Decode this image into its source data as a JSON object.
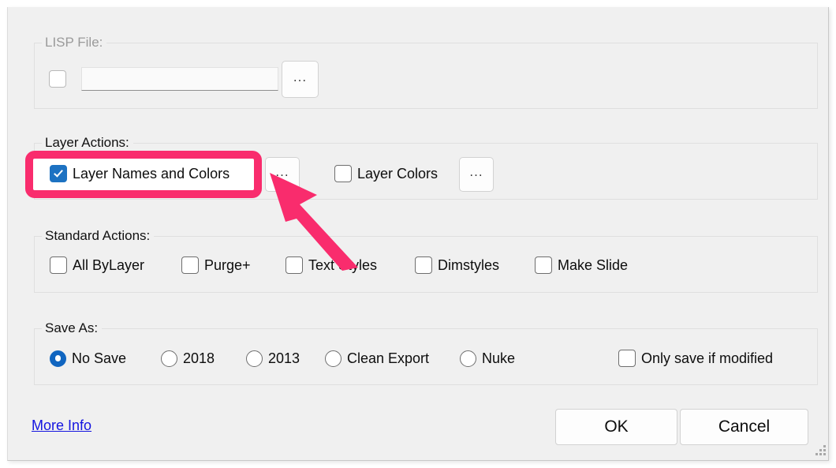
{
  "window": {
    "background_color": "#f0f0f0"
  },
  "annotation": {
    "highlight_color": "#f92c6d",
    "arrow_color": "#f92c6d",
    "highlight_target": "Layer Names and Colors",
    "arrow_target": "layer-names-and-colors-browse-button"
  },
  "colors": {
    "accent_blue": "#1d72c2",
    "radio_blue": "#1065c0",
    "link_blue": "#1414e0",
    "group_border": "#dfdfdf"
  },
  "lisp_file": {
    "group_label": "LISP File:",
    "checkbox_checked": false,
    "enabled": false,
    "path_value": "",
    "path_placeholder": "",
    "browse_label": "..."
  },
  "layer_actions": {
    "group_label": "Layer Actions:",
    "items": [
      {
        "label": "Layer Names and Colors",
        "checked": true,
        "browse_label": "...",
        "highlighted": true
      },
      {
        "label": "Layer Colors",
        "checked": false,
        "browse_label": "...",
        "highlighted": false
      }
    ]
  },
  "standard_actions": {
    "group_label": "Standard Actions:",
    "items": [
      {
        "label": "All ByLayer",
        "checked": false
      },
      {
        "label": "Purge+",
        "checked": false
      },
      {
        "label": "Text Styles",
        "checked": false
      },
      {
        "label": "Dimstyles",
        "checked": false
      },
      {
        "label": "Make Slide",
        "checked": false
      }
    ]
  },
  "save_as": {
    "group_label": "Save As:",
    "options": [
      {
        "label": "No Save",
        "selected": true
      },
      {
        "label": "2018",
        "selected": false
      },
      {
        "label": "2013",
        "selected": false
      },
      {
        "label": "Clean Export",
        "selected": false
      },
      {
        "label": "Nuke",
        "selected": false
      }
    ],
    "only_save_if_modified": {
      "label": "Only save if modified",
      "checked": false
    }
  },
  "footer": {
    "more_info_label": "More Info",
    "ok_label": "OK",
    "cancel_label": "Cancel"
  }
}
